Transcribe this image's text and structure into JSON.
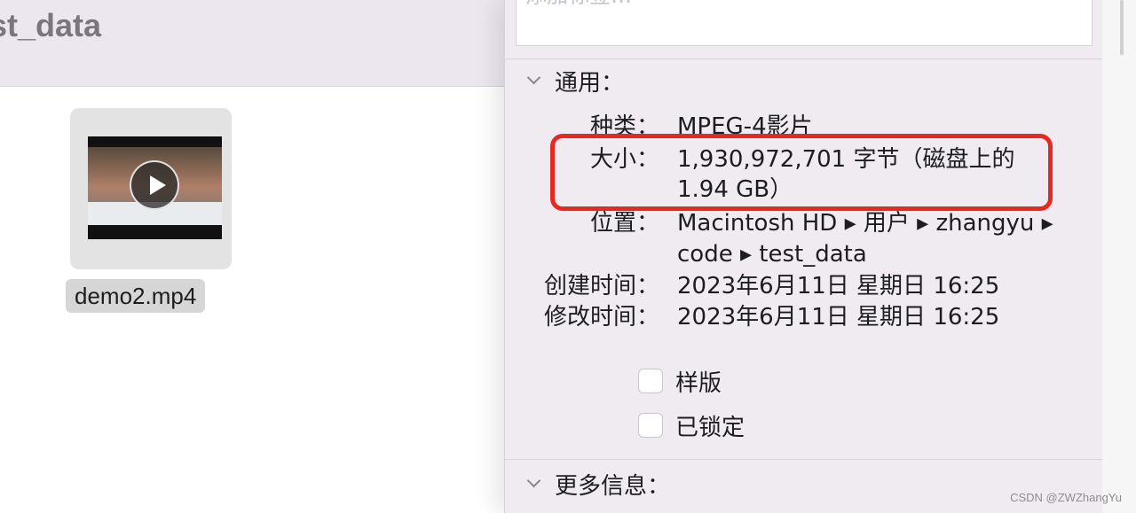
{
  "finder": {
    "title": "st_data",
    "file": {
      "name": "demo2.mp4"
    }
  },
  "info": {
    "tags_placeholder": "添加标签…",
    "general": {
      "title": "通用：",
      "kind_label": "种类：",
      "kind_value": "MPEG-4影片",
      "size_label": "大小：",
      "size_value_line1": "1,930,972,701 字节（磁盘上的",
      "size_value_line2": "1.94 GB）",
      "location_label": "位置：",
      "location_line1": "Macintosh HD ▸ 用户 ▸ zhangyu ▸",
      "location_line2": "code ▸ test_data",
      "created_label": "创建时间：",
      "created_value": "2023年6月11日 星期日 16:25",
      "modified_label": "修改时间：",
      "modified_value": "2023年6月11日 星期日 16:25",
      "stationery_label": "样版",
      "locked_label": "已锁定",
      "stationery_checked": false,
      "locked_checked": false
    },
    "more_info": {
      "title": "更多信息："
    }
  },
  "watermark": "CSDN @ZWZhangYu",
  "colors": {
    "highlight": "#e8291d",
    "panel_bg": "#efebf0"
  }
}
